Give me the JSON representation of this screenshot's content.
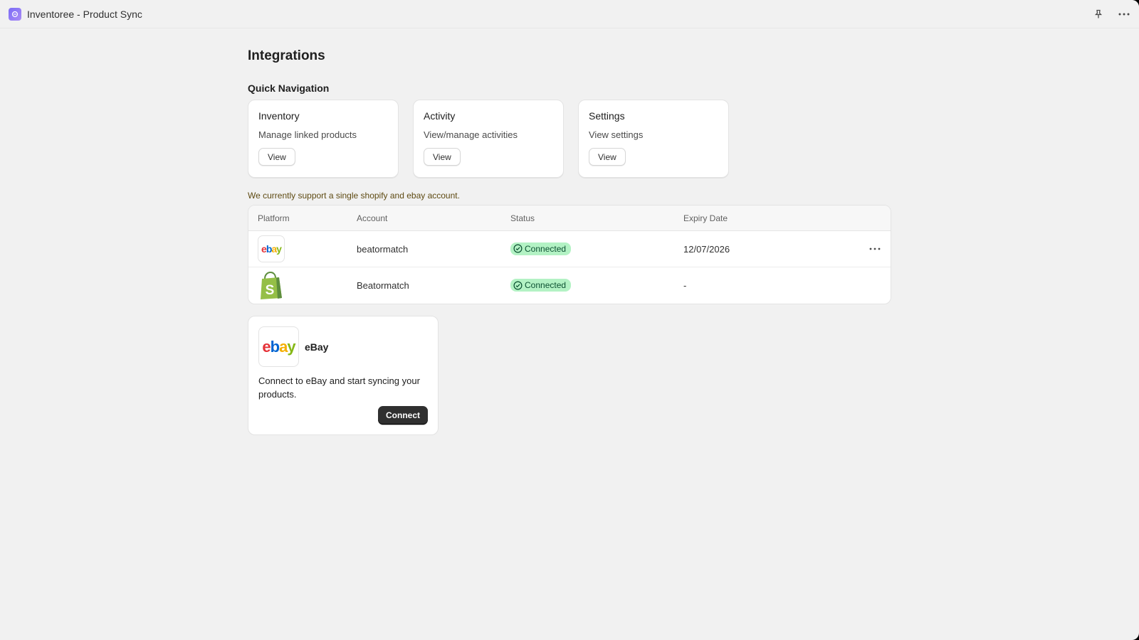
{
  "app": {
    "title": "Inventoree - Product Sync",
    "icon": "app-logo-icon"
  },
  "page": {
    "title": "Integrations",
    "quick_nav_title": "Quick Navigation"
  },
  "nav_cards": [
    {
      "title": "Inventory",
      "description": "Manage linked products",
      "button": "View"
    },
    {
      "title": "Activity",
      "description": "View/manage activities",
      "button": "View"
    },
    {
      "title": "Settings",
      "description": "View settings",
      "button": "View"
    }
  ],
  "support_note": "We currently support a single shopify and ebay account.",
  "table": {
    "headers": {
      "platform": "Platform",
      "account": "Account",
      "status": "Status",
      "expiry": "Expiry Date"
    },
    "rows": [
      {
        "platform": "ebay",
        "account": "beatormatch",
        "status": "Connected",
        "expiry": "12/07/2026",
        "has_actions": true
      },
      {
        "platform": "shopify",
        "account": "Beatormatch",
        "status": "Connected",
        "expiry": "-",
        "has_actions": false
      }
    ]
  },
  "connect_card": {
    "name": "eBay",
    "description": "Connect to eBay and start syncing your products.",
    "button": "Connect"
  },
  "colors": {
    "badge_bg": "#b3f2c4",
    "badge_text": "#0c5132",
    "primary_button": "#303030",
    "note_text": "#5e4a12"
  }
}
